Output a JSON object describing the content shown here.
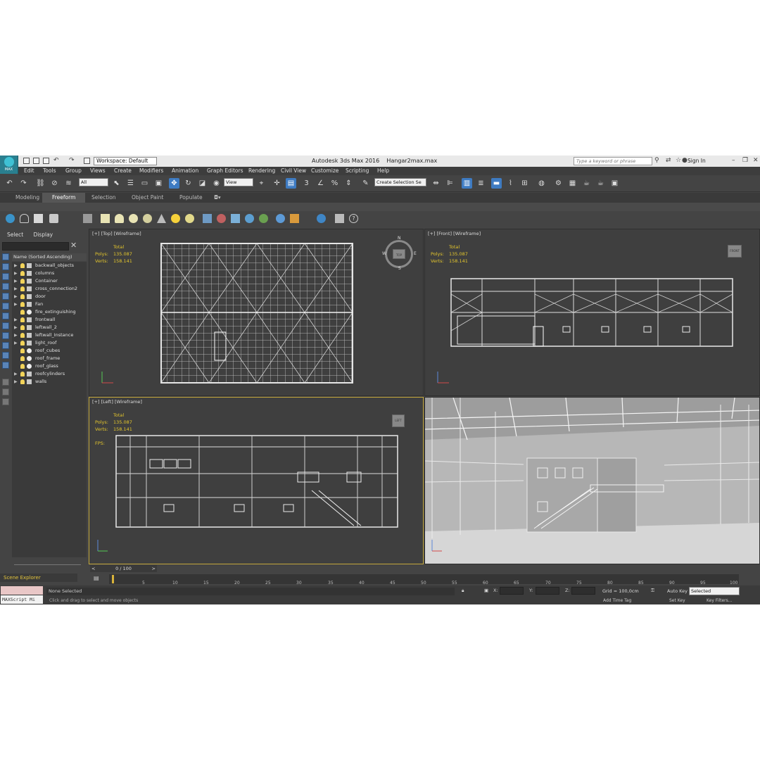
{
  "titlebar": {
    "app_title": "Autodesk 3ds Max 2016",
    "file_name": "Hangar2max.max",
    "workspace": "Workspace: Default",
    "search_placeholder": "Type a keyword or phrase",
    "sign_in": "Sign In"
  },
  "menu": [
    "Edit",
    "Tools",
    "Group",
    "Views",
    "Create",
    "Modifiers",
    "Animation",
    "Graph Editors",
    "Rendering",
    "Civil View",
    "Customize",
    "Scripting",
    "Help"
  ],
  "toolbar": {
    "selection_filter": "All",
    "reference_coord": "View",
    "selection_set": "Create Selection Se"
  },
  "ribbon_tabs": [
    "Modeling",
    "Freeform",
    "Selection",
    "Object Paint",
    "Populate"
  ],
  "ribbon_active": "Freeform",
  "scene_explorer": {
    "tabs": [
      "Select",
      "Display"
    ],
    "column_header": "Name (Sorted Ascending)",
    "items": [
      {
        "name": "backwall_objects",
        "expandable": true
      },
      {
        "name": "columns",
        "expandable": true
      },
      {
        "name": "Container",
        "expandable": true
      },
      {
        "name": "cross_connection2",
        "expandable": true
      },
      {
        "name": "door",
        "expandable": true
      },
      {
        "name": "Fan",
        "expandable": true
      },
      {
        "name": "fire_extinguishing",
        "expandable": false
      },
      {
        "name": "frontwall",
        "expandable": true
      },
      {
        "name": "leftwall_2",
        "expandable": true
      },
      {
        "name": "leftwall_Instance",
        "expandable": true
      },
      {
        "name": "light_roof",
        "expandable": true
      },
      {
        "name": "roof_cubes",
        "expandable": false
      },
      {
        "name": "roof_frame",
        "expandable": false
      },
      {
        "name": "roof_glass",
        "expandable": false
      },
      {
        "name": "roofcylinders",
        "expandable": true
      },
      {
        "name": "walls",
        "expandable": true
      }
    ],
    "tab_label": "Scene Explorer"
  },
  "viewports": {
    "top": {
      "label": "[+] [Top] [Wireframe]",
      "total": "Total",
      "polys_label": "Polys:",
      "polys": "135.087",
      "verts_label": "Verts:",
      "verts": "158.141",
      "compass": [
        "N",
        "E",
        "S",
        "W"
      ],
      "cube_label": "TOP"
    },
    "front": {
      "label": "[+] [Front] [Wireframe]",
      "total": "Total",
      "polys_label": "Polys:",
      "polys": "135.087",
      "verts_label": "Verts:",
      "verts": "158.141",
      "cube_label": "FRONT"
    },
    "left": {
      "label": "[+] [Left] [Wireframe]",
      "total": "Total",
      "polys_label": "Polys:",
      "polys": "135.087",
      "verts_label": "Verts:",
      "verts": "158.141",
      "fps_label": "FPS:",
      "cube_label": "LEFT"
    }
  },
  "timeline": {
    "slider": "0 / 100",
    "ticks": [
      "5",
      "10",
      "15",
      "20",
      "25",
      "30",
      "35",
      "40",
      "45",
      "50",
      "55",
      "60",
      "65",
      "70",
      "75",
      "80",
      "85",
      "90",
      "95",
      "100"
    ]
  },
  "status": {
    "maxscript": "MAXScript Mi",
    "selection": "None Selected",
    "hint": "Click and drag to select and move objects",
    "x_label": "X:",
    "y_label": "Y:",
    "z_label": "Z:",
    "grid": "Grid = 100,0cm",
    "add_time_tag": "Add Time Tag",
    "auto_key": "Auto Key",
    "set_key": "Set Key",
    "key_mode": "Selected",
    "key_filters": "Key Filters..."
  }
}
